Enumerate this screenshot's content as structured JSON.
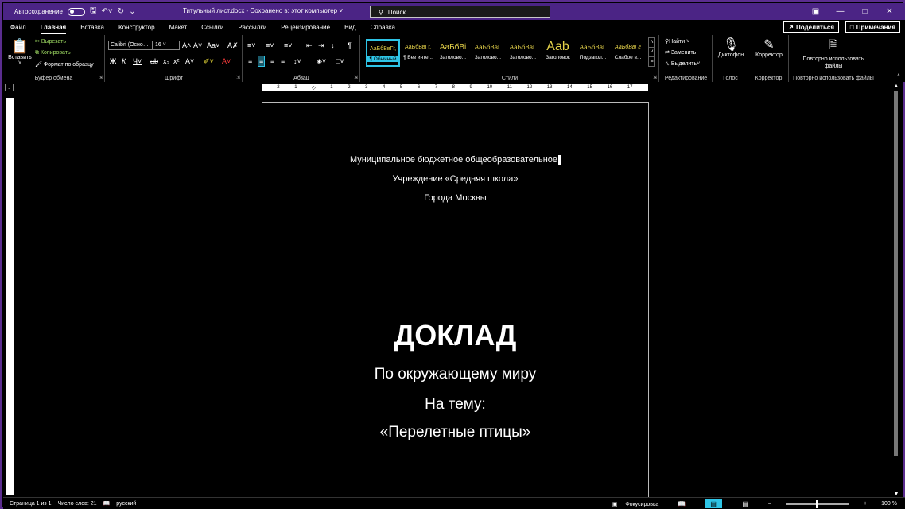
{
  "titlebar": {
    "autosave_label": "Автосохранение",
    "doc_title": "Титульный лист.docx  -  Сохранено в: этот компьютер",
    "search_placeholder": "Поиск"
  },
  "tabs": [
    "Файл",
    "Главная",
    "Вставка",
    "Конструктор",
    "Макет",
    "Ссылки",
    "Рассылки",
    "Рецензирование",
    "Вид",
    "Справка"
  ],
  "actions": {
    "share": "Поделиться",
    "comments": "Примечания"
  },
  "clipboard": {
    "paste": "Вставить",
    "cut": "Вырезать",
    "copy": "Копировать",
    "format_painter": "Формат по образцу",
    "label": "Буфер обмена"
  },
  "font": {
    "family": "Calibri (Осно…",
    "size": "16",
    "label": "Шрифт"
  },
  "paragraph": {
    "label": "Абзац"
  },
  "styles": {
    "items": [
      {
        "preview": "АаБбВвГг,",
        "name": "¶ Обычный"
      },
      {
        "preview": "АаБбВвГг,",
        "name": "¶ Без инте..."
      },
      {
        "preview": "АаБбВі",
        "name": "Заголово..."
      },
      {
        "preview": "АаБбВвГ",
        "name": "Заголово..."
      },
      {
        "preview": "АаБбВвГ",
        "name": "Заголово..."
      },
      {
        "preview": "Aab",
        "name": "Заголовок"
      },
      {
        "preview": "АаБбВвГ",
        "name": "Подзагол..."
      },
      {
        "preview": "АаБбВвГг",
        "name": "Слабое в..."
      }
    ],
    "label": "Стили"
  },
  "editing": {
    "find": "Найти",
    "replace": "Заменить",
    "select": "Выделить",
    "label": "Редактирование"
  },
  "voice": {
    "dictate": "Диктофон",
    "label": "Голос"
  },
  "editor": {
    "name": "Корректор",
    "label": "Корректор"
  },
  "reuse": {
    "name": "Повторно использовать файлы",
    "label": "Повторно использовать файлы"
  },
  "ruler_ticks": [
    "2",
    "1",
    "1",
    "2",
    "3",
    "4",
    "5",
    "6",
    "7",
    "8",
    "9",
    "10",
    "11",
    "12",
    "13",
    "14",
    "15",
    "16",
    "17"
  ],
  "document": {
    "line1": "Муниципальное бюджетное общеобразовательное",
    "line2": "Учреждение «Средняя школа»",
    "line3": "Города Москвы",
    "title": "ДОКЛАД",
    "subject": "По окружающему миру",
    "topic_label": "На тему:",
    "topic": "«Перелетные птицы»"
  },
  "status": {
    "page": "Страница 1 из 1",
    "words": "Число слов: 21",
    "lang": "русский",
    "focus": "Фокусировка",
    "zoom": "100 %"
  }
}
